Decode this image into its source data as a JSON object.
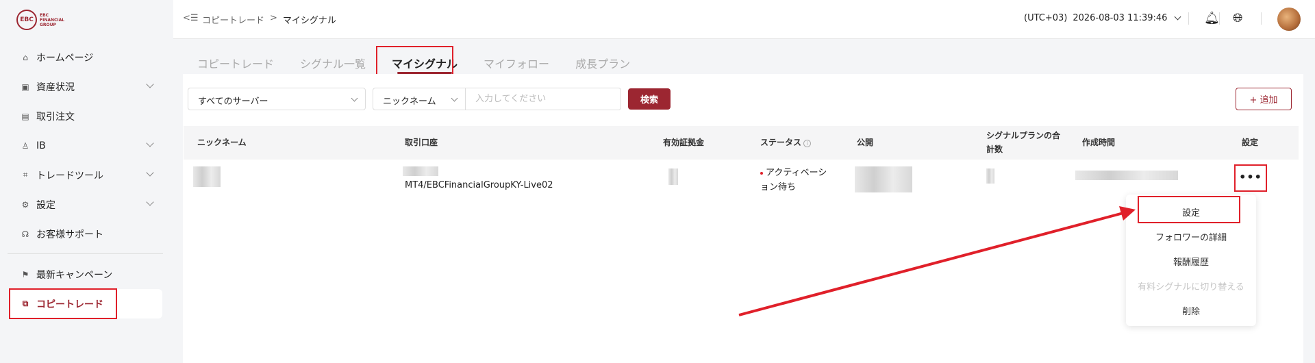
{
  "logo": {
    "mark": "EBC",
    "text": "EBC FINANCIAL GROUP"
  },
  "sidebar": {
    "items": [
      {
        "label": "ホームページ",
        "icon": "home-icon",
        "glyph": "⌂"
      },
      {
        "label": "資産状況",
        "icon": "wallet-icon",
        "glyph": "▣"
      },
      {
        "label": "取引注文",
        "icon": "order-icon",
        "glyph": "▤"
      },
      {
        "label": "IB",
        "icon": "user-icon",
        "glyph": "♙"
      },
      {
        "label": "トレードツール",
        "icon": "tool-icon",
        "glyph": "⌗"
      },
      {
        "label": "設定",
        "icon": "settings-icon",
        "glyph": "⚙"
      },
      {
        "label": "お客様サポート",
        "icon": "headset-icon",
        "glyph": "☊"
      }
    ],
    "items2": [
      {
        "label": "最新キャンペーン",
        "icon": "flag-icon",
        "glyph": "⚑"
      },
      {
        "label": "コピートレード",
        "icon": "copy-trade-icon",
        "glyph": "⧉"
      }
    ]
  },
  "header": {
    "back_icon": "<☰",
    "breadcrumb": [
      "コピートレード",
      ">",
      "マイシグナル"
    ],
    "timezone": "(UTC+03)",
    "datetime": "2026-08-03 11:39:46"
  },
  "tabs": [
    "コピートレード",
    "シグナル一覧",
    "マイシグナル",
    "マイフォロー",
    "成長プラン"
  ],
  "filters": {
    "server": "すべてのサーバー",
    "field": "ニックネーム",
    "placeholder": "入力してください",
    "search_label": "検索",
    "add_label": "+ 追加"
  },
  "table": {
    "headers": [
      "ニックネーム",
      "取引口座",
      "有効証拠金",
      "ステータス",
      "公開",
      "シグナルプランの合計数",
      "作成時間",
      "設定"
    ],
    "row": {
      "account": "MT4/EBCFinancialGroupKY-Live02",
      "status_line1": "アクティベーシ",
      "status_line2": "ョン待ち",
      "more": "•••"
    }
  },
  "menu": {
    "items": [
      {
        "label": "設定",
        "disabled": false
      },
      {
        "label": "フォロワーの詳細",
        "disabled": false
      },
      {
        "label": "報酬履歴",
        "disabled": false
      },
      {
        "label": "有料シグナルに切り替える",
        "disabled": true
      },
      {
        "label": "削除",
        "disabled": false
      }
    ]
  },
  "colors": {
    "brand": "#9c2631",
    "highlight": "#e0202a"
  }
}
